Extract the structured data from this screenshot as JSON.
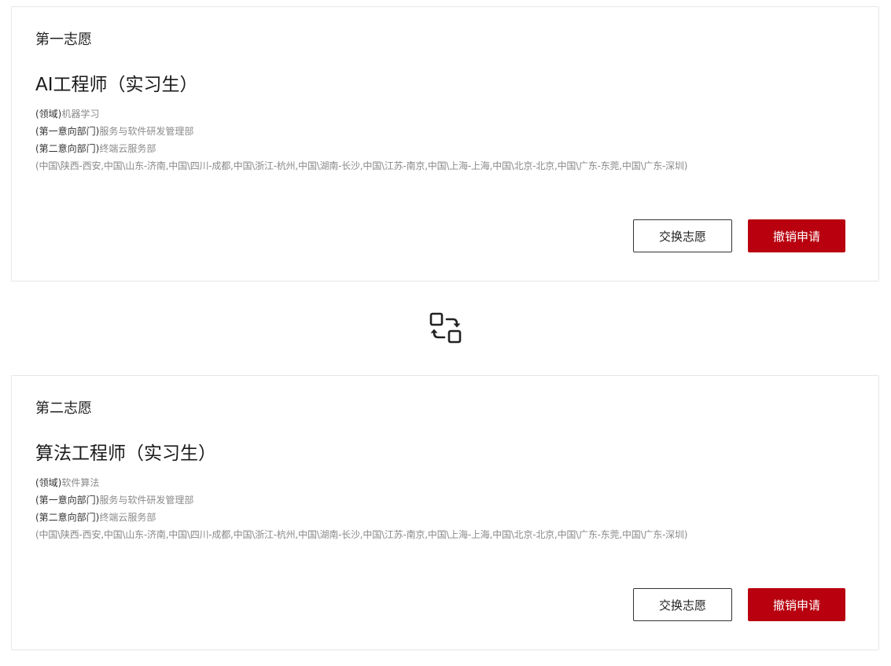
{
  "choices": [
    {
      "label": "第一志愿",
      "title": "AI工程师（实习生）",
      "domain_key": "(领域)",
      "domain_val": "机器学习",
      "dept1_key": "(第一意向部门)",
      "dept1_val": "服务与软件研发管理部",
      "dept2_key": "(第二意向部门)",
      "dept2_val": "终端云服务部",
      "locations": "(中国\\陕西-西安,中国\\山东-济南,中国\\四川-成都,中国\\浙江-杭州,中国\\湖南-长沙,中国\\江苏-南京,中国\\上海-上海,中国\\北京-北京,中国\\广东-东莞,中国\\广东-深圳)",
      "swap_label": "交换志愿",
      "cancel_label": "撤销申请"
    },
    {
      "label": "第二志愿",
      "title": "算法工程师（实习生）",
      "domain_key": "(领域)",
      "domain_val": "软件算法",
      "dept1_key": "(第一意向部门)",
      "dept1_val": "服务与软件研发管理部",
      "dept2_key": "(第二意向部门)",
      "dept2_val": "终端云服务部",
      "locations": "(中国\\陕西-西安,中国\\山东-济南,中国\\四川-成都,中国\\浙江-杭州,中国\\湖南-长沙,中国\\江苏-南京,中国\\上海-上海,中国\\北京-北京,中国\\广东-东莞,中国\\广东-深圳)",
      "swap_label": "交换志愿",
      "cancel_label": "撤销申请"
    }
  ],
  "swap_icon": "swap-order-icon",
  "colors": {
    "accent": "#b8000f",
    "border": "#e6e6e6",
    "muted_text": "#8a8a8a"
  }
}
